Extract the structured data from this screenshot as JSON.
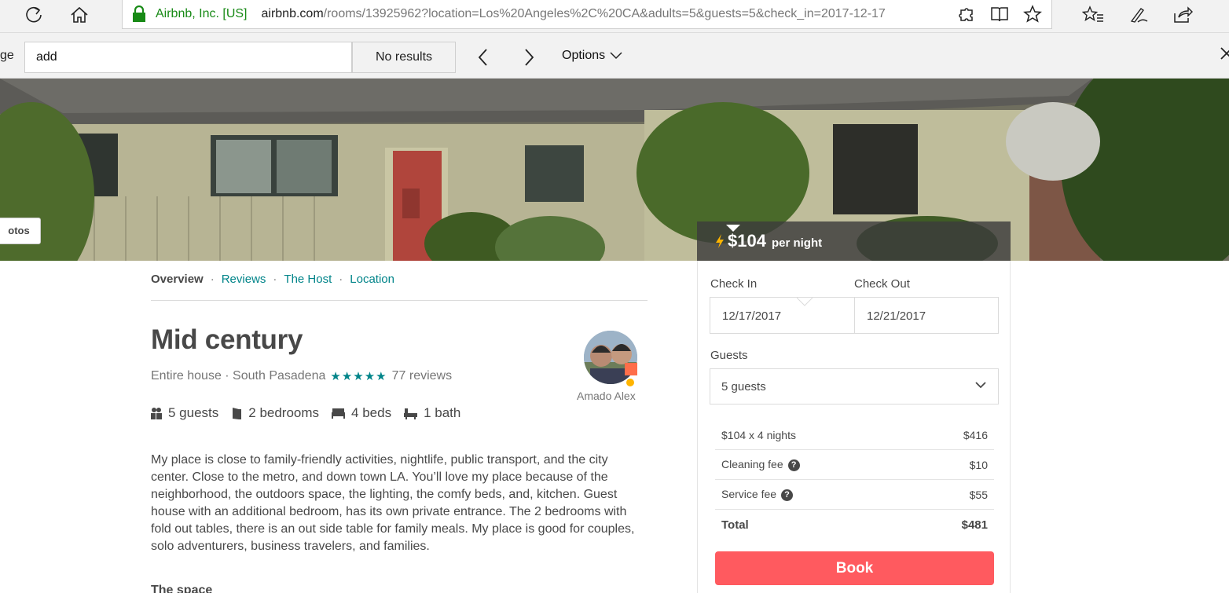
{
  "browser": {
    "org": "Airbnb, Inc. [US]",
    "url_host": "airbnb.com",
    "url_rest": "/rooms/13925962?location=Los%20Angeles%2C%20CA&adults=5&guests=5&check_in=2017-12-17"
  },
  "find": {
    "cut_label": "ge",
    "query": "add",
    "results": "No results",
    "options_label": "Options"
  },
  "hero": {
    "photos_label": "otos"
  },
  "price": {
    "amount": "$104",
    "unit": "per night"
  },
  "subnav": {
    "overview": "Overview",
    "reviews": "Reviews",
    "host": "The Host",
    "location": "Location",
    "separator": "·"
  },
  "listing": {
    "title": "Mid century",
    "type": "Entire house · South Pasadena",
    "rating_stars": 5,
    "reviews": "77 reviews",
    "host_name": "Amado Alex",
    "guests": "5 guests",
    "bedrooms": "2 bedrooms",
    "beds": "4 beds",
    "baths": "1 bath",
    "description": "My place is close to family-friendly activities, nightlife, public transport, and the city center. Close to the metro, and down town LA. You’ll love my place because of the neighborhood, the outdoors space, the lighting, the comfy beds, and, kitchen. Guest house with an additional bedroom, has its own private entrance. The 2 bedrooms with fold out tables, there is an out side table for family meals. My place is good for couples, solo adventurers, business travelers, and families.",
    "space_heading": "The space"
  },
  "booking": {
    "check_in_label": "Check In",
    "check_out_label": "Check Out",
    "check_in": "12/17/2017",
    "check_out": "12/21/2017",
    "guests_label": "Guests",
    "guests_value": "5 guests",
    "fees": [
      {
        "label": "$104 x 4 nights",
        "amount": "$416"
      },
      {
        "label": "Cleaning fee",
        "amount": "$10"
      },
      {
        "label": "Service fee",
        "amount": "$55"
      },
      {
        "label": "Total",
        "amount": "$481"
      }
    ],
    "book_label": "Book"
  },
  "colors": {
    "accent": "#008489",
    "book": "#ff5a5f",
    "secure": "#188a16",
    "bolt": "#ffb400"
  }
}
